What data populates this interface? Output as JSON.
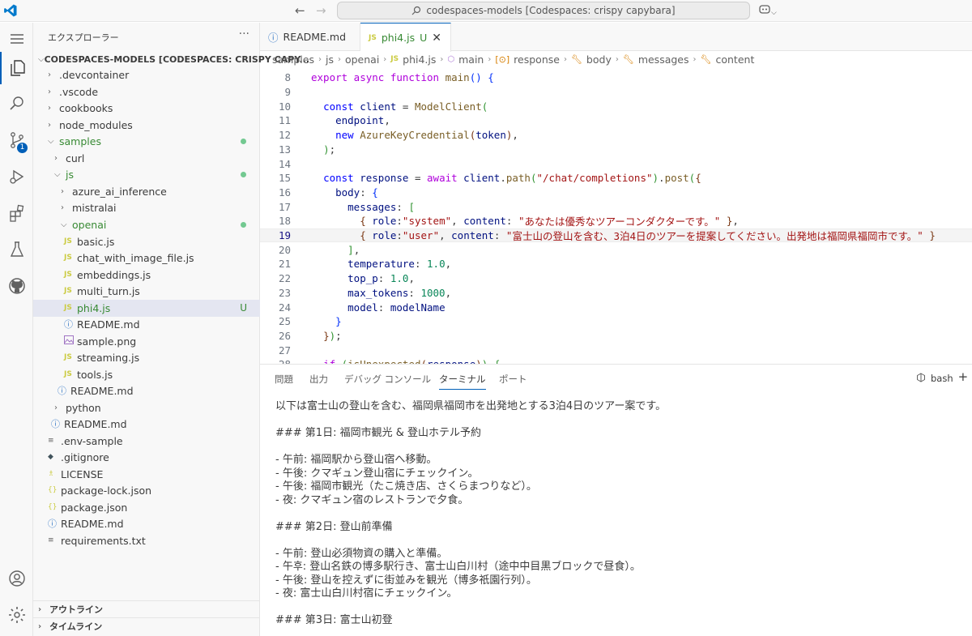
{
  "titlebar": {
    "search_text": "codespaces-models [Codespaces: crispy capybara]"
  },
  "activity_bar": {
    "scm_badge": "1",
    "accent": "#005fb8"
  },
  "sidebar": {
    "header": "エクスプローラー",
    "more": "···",
    "root": "CODESPACES-MODELS [CODESPACES: CRISPY CAPY...",
    "items": [
      {
        "label": ".devcontainer",
        "kind": "folder"
      },
      {
        "label": ".vscode",
        "kind": "folder"
      },
      {
        "label": "cookbooks",
        "kind": "folder"
      },
      {
        "label": "node_modules",
        "kind": "folder"
      },
      {
        "label": "samples",
        "kind": "folder-open"
      },
      {
        "label": "curl",
        "kind": "folder"
      },
      {
        "label": "js",
        "kind": "folder-open"
      },
      {
        "label": "azure_ai_inference",
        "kind": "folder"
      },
      {
        "label": "mistralai",
        "kind": "folder"
      },
      {
        "label": "openai",
        "kind": "folder-open"
      },
      {
        "label": "basic.js",
        "kind": "js"
      },
      {
        "label": "chat_with_image_file.js",
        "kind": "js"
      },
      {
        "label": "embeddings.js",
        "kind": "js"
      },
      {
        "label": "multi_turn.js",
        "kind": "js"
      },
      {
        "label": "phi4.js",
        "kind": "js"
      },
      {
        "label": "README.md",
        "kind": "info"
      },
      {
        "label": "sample.png",
        "kind": "image"
      },
      {
        "label": "streaming.js",
        "kind": "js"
      },
      {
        "label": "tools.js",
        "kind": "js"
      },
      {
        "label": "README.md",
        "kind": "info"
      },
      {
        "label": "python",
        "kind": "folder"
      },
      {
        "label": "README.md",
        "kind": "info"
      },
      {
        "label": ".env-sample",
        "kind": "text"
      },
      {
        "label": ".gitignore",
        "kind": "git"
      },
      {
        "label": "LICENSE",
        "kind": "license"
      },
      {
        "label": "package-lock.json",
        "kind": "json"
      },
      {
        "label": "package.json",
        "kind": "json"
      },
      {
        "label": "README.md",
        "kind": "info"
      },
      {
        "label": "requirements.txt",
        "kind": "text"
      }
    ],
    "untracked_flag": "U",
    "outline": "アウトライン",
    "timeline": "タイムライン"
  },
  "tabs": [
    {
      "label": "README.md"
    },
    {
      "label": "phi4.js",
      "flag": "U"
    }
  ],
  "breadcrumb": [
    "samples",
    "js",
    "openai",
    "phi4.js",
    "main",
    "response",
    "body",
    "messages",
    "content"
  ],
  "editor": {
    "line_numbers": [
      "8",
      "9",
      "10",
      "11",
      "12",
      "13",
      "14",
      "15",
      "16",
      "17",
      "18",
      "19",
      "20",
      "21",
      "22",
      "23",
      "24",
      "25",
      "26",
      "27",
      "28"
    ],
    "current_line": "19",
    "strings": {
      "system": "あなたは優秀なツアーコンダクターです。",
      "user": "富士山の登山を含む、3泊4日のツアーを提案してください。出発地は福岡県福岡市です。",
      "path": "/chat/completions",
      "role_system": "system",
      "role_user": "user"
    },
    "values": {
      "temperature": "1.0",
      "top_p": "1.0",
      "max_tokens": "1000"
    }
  },
  "panel": {
    "tabs": [
      "問題",
      "出力",
      "デバッグ コンソール",
      "ターミナル",
      "ポート"
    ],
    "shell": "bash",
    "terminal_lines": [
      "以下は富士山の登山を含む、福岡県福岡市を出発地とする3泊4日のツアー案です。",
      "",
      "### 第1日: 福岡市観光 & 登山ホテル予約",
      "",
      "- 午前: 福岡駅から登山宿へ移動。",
      "- 午後: クマギュン登山宿にチェックイン。",
      "- 午後: 福岡市観光（たこ焼き店、さくらまつりなど）。",
      "- 夜: クマギュン宿のレストランで夕食。",
      "",
      "### 第2日: 登山前準備",
      "",
      "- 午前: 登山必須物資の購入と準備。",
      "- 午후: 登山名鉄の博多駅行き、富士山白川村（途中中目黒ブロックで昼食）。",
      "- 午後: 登山を控えずに街並みを観光（博多祇園行列）。",
      "- 夜: 富士山白川村宿にチェックイン。",
      "",
      "### 第3日: 富士山初登"
    ]
  }
}
